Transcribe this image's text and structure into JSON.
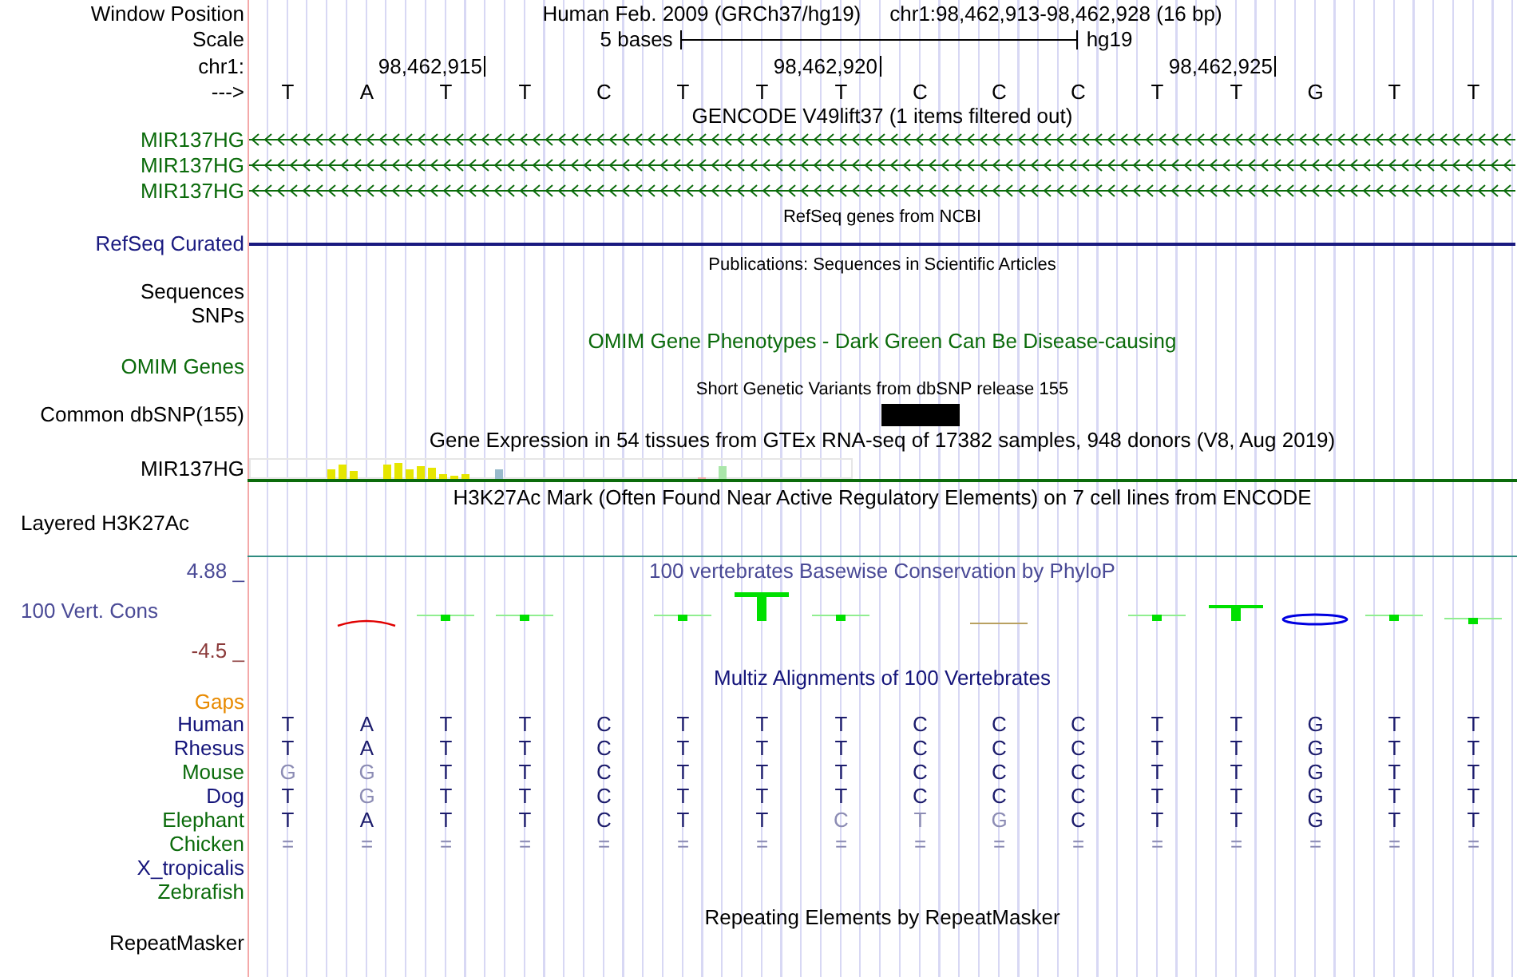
{
  "position": {
    "label": "Window Position",
    "assembly": "Human Feb. 2009 (GRCh37/hg19)",
    "range": "chr1:98,462,913-98,462,928 (16 bp)"
  },
  "scale": {
    "label": "Scale",
    "text": "5 bases",
    "assembly": "hg19"
  },
  "ruler": {
    "label": "chr1:"
  },
  "sequence": {
    "label": "--->",
    "bases": [
      {
        "base": "T"
      },
      {
        "base": "A"
      },
      {
        "base": "T",
        "tick": "98,462,915"
      },
      {
        "base": "T"
      },
      {
        "base": "C"
      },
      {
        "base": "T"
      },
      {
        "base": "T"
      },
      {
        "base": "T",
        "tick": "98,462,920"
      },
      {
        "base": "C"
      },
      {
        "base": "C"
      },
      {
        "base": "C"
      },
      {
        "base": "T"
      },
      {
        "base": "T",
        "tick": "98,462,925"
      },
      {
        "base": "G"
      },
      {
        "base": "T"
      },
      {
        "base": "T"
      }
    ]
  },
  "tracks": [
    {
      "kind": "gene",
      "title": "GENCODE V49lift37 (1 items filtered out)",
      "items": [
        {
          "name": "MIR137HG",
          "color": "#0b6b0b"
        },
        {
          "name": "MIR137HG",
          "color": "#0b6b0b"
        },
        {
          "name": "MIR137HG",
          "color": "#0b6b0b"
        }
      ]
    },
    {
      "kind": "refseq",
      "title": "RefSeq genes from NCBI",
      "label": "RefSeq Curated",
      "color": "#1a1a80"
    },
    {
      "kind": "empty",
      "title": "Publications: Sequences in Scientific Articles",
      "labels": [
        "Sequences",
        "SNPs"
      ]
    },
    {
      "kind": "omim",
      "title": "OMIM Gene Phenotypes - Dark Green Can Be Disease-causing",
      "label": "OMIM Genes",
      "color": "#0b6b0b"
    },
    {
      "kind": "snp",
      "title": "Short Genetic Variants from dbSNP release 155",
      "label": "Common dbSNP(155)"
    },
    {
      "kind": "gtex",
      "title": "Gene Expression in 54 tissues from GTEx RNA-seq of 17382 samples, 948 donors (V8, Aug 2019)",
      "label": "MIR137HG"
    },
    {
      "kind": "h3k27ac",
      "title": "H3K27Ac Mark (Often Found Near Active Regulatory Elements) on 7 cell lines from ENCODE",
      "label": "Layered H3K27Ac"
    },
    {
      "kind": "conservation",
      "title": "100 vertebrates Basewise Conservation by PhyloP",
      "label": "100 Vert. Cons",
      "max": "4.88 _",
      "min": "-4.5 _",
      "color": "#4a4a96"
    },
    {
      "kind": "multiz",
      "title": "Multiz Alignments of 100 Vertebrates",
      "gaps_label": "Gaps",
      "color": "#14147a",
      "species": [
        {
          "name": "Human",
          "color": "#14147a",
          "bases": [
            "T",
            "A",
            "T",
            "T",
            "C",
            "T",
            "T",
            "T",
            "C",
            "C",
            "C",
            "T",
            "T",
            "G",
            "T",
            "T"
          ],
          "dimmed": [
            false,
            false,
            false,
            false,
            false,
            false,
            false,
            false,
            false,
            false,
            false,
            false,
            false,
            false,
            false,
            false
          ]
        },
        {
          "name": "Rhesus",
          "color": "#14147a",
          "bases": [
            "T",
            "A",
            "T",
            "T",
            "C",
            "T",
            "T",
            "T",
            "C",
            "C",
            "C",
            "T",
            "T",
            "G",
            "T",
            "T"
          ],
          "dimmed": [
            false,
            false,
            false,
            false,
            false,
            false,
            false,
            false,
            false,
            false,
            false,
            false,
            false,
            false,
            false,
            false
          ]
        },
        {
          "name": "Mouse",
          "color": "#0b6b0b",
          "bases": [
            "G",
            "G",
            "T",
            "T",
            "C",
            "T",
            "T",
            "T",
            "C",
            "C",
            "C",
            "T",
            "T",
            "G",
            "T",
            "T"
          ],
          "dimmed": [
            true,
            true,
            false,
            false,
            false,
            false,
            false,
            false,
            false,
            false,
            false,
            false,
            false,
            false,
            false,
            false
          ]
        },
        {
          "name": "Dog",
          "color": "#14147a",
          "bases": [
            "T",
            "G",
            "T",
            "T",
            "C",
            "T",
            "T",
            "T",
            "C",
            "C",
            "C",
            "T",
            "T",
            "G",
            "T",
            "T"
          ],
          "dimmed": [
            false,
            true,
            false,
            false,
            false,
            false,
            false,
            false,
            false,
            false,
            false,
            false,
            false,
            false,
            false,
            false
          ]
        },
        {
          "name": "Elephant",
          "color": "#0b6b0b",
          "bases": [
            "T",
            "A",
            "T",
            "T",
            "C",
            "T",
            "T",
            "C",
            "T",
            "G",
            "C",
            "T",
            "T",
            "G",
            "T",
            "T"
          ],
          "dimmed": [
            false,
            false,
            false,
            false,
            false,
            false,
            false,
            true,
            true,
            true,
            false,
            false,
            false,
            false,
            false,
            false
          ]
        },
        {
          "name": "Chicken",
          "color": "#0b6b0b",
          "bases": [
            "=",
            "=",
            "=",
            "=",
            "=",
            "=",
            "=",
            "=",
            "=",
            "=",
            "=",
            "=",
            "=",
            "=",
            "=",
            "="
          ],
          "dimmed": [
            true,
            true,
            true,
            true,
            true,
            true,
            true,
            true,
            true,
            true,
            true,
            true,
            true,
            true,
            true,
            true
          ]
        },
        {
          "name": "X_tropicalis",
          "color": "#14147a"
        },
        {
          "name": "Zebrafish",
          "color": "#0b6b0b"
        }
      ]
    },
    {
      "kind": "repeat",
      "title": "Repeating Elements by RepeatMasker",
      "label": "RepeatMasker"
    }
  ]
}
